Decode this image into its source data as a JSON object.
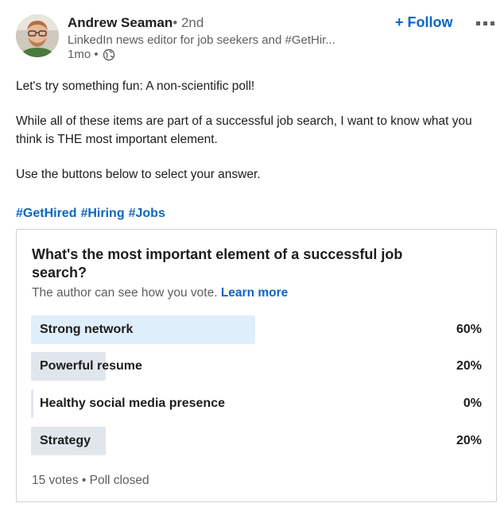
{
  "author": {
    "name": "Andrew Seaman",
    "degree": "• 2nd",
    "headline": "LinkedIn news editor for job seekers and #GetHir...",
    "time": "1mo •",
    "follow_label": "+ Follow"
  },
  "post": {
    "paragraphs": [
      "Let's try something fun: A non-scientific poll!",
      "While all of these items are part of a successful job search, I want to know what you think is THE most important element.",
      "Use the buttons below to select your answer."
    ],
    "hashtags": [
      "#GetHired",
      "#Hiring",
      "#Jobs"
    ]
  },
  "poll": {
    "question": "What's the most important element of a successful job search?",
    "note": "The author can see how you vote.",
    "learn_more": "Learn more",
    "options": [
      {
        "label": "Strong network",
        "percent_text": "60%",
        "percent": 60
      },
      {
        "label": "Powerful resume",
        "percent_text": "20%",
        "percent": 20
      },
      {
        "label": "Healthy social media presence",
        "percent_text": "0%",
        "percent": 0
      },
      {
        "label": "Strategy",
        "percent_text": "20%",
        "percent": 20
      }
    ],
    "footer": "15 votes • Poll closed"
  },
  "colors": {
    "accent": "#0a66c2",
    "winner_bar": "#dfeefb",
    "bar": "#e0e6ec"
  }
}
